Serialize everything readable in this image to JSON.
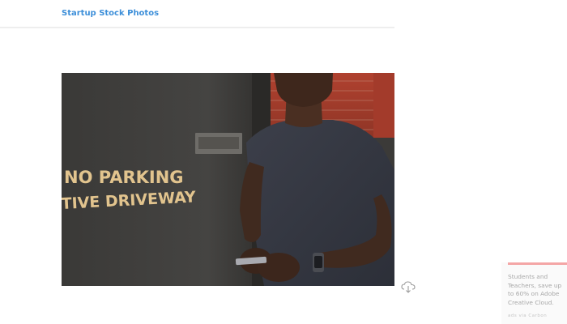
{
  "header": {
    "logo_text": "Startup Stock Photos"
  },
  "photo": {
    "sign_line_1": "NO PARKING",
    "sign_line_2": "TIVE DRIVEWAY"
  },
  "download": {
    "icon": "cloud-download-icon"
  },
  "ad": {
    "text": "Students and Teachers, save up to 60% on Adobe Creative Cloud.",
    "via": "ads via Carbon",
    "accent_color": "#f4a6a6"
  },
  "colors": {
    "logo": "#3d8fd9",
    "header_border": "#eeeeee"
  }
}
